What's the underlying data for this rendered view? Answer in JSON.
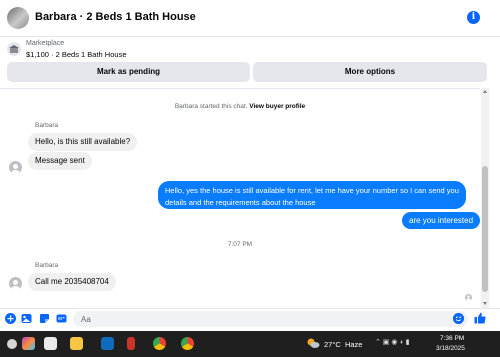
{
  "header": {
    "title": "Barbara · 2 Beds 1 Bath House",
    "info_icon": "info-icon"
  },
  "listing": {
    "label": "Marketplace",
    "detail": "$1,100 · 2 Beds 1 Bath House",
    "pending_label": "Mark as pending",
    "options_label": "More options"
  },
  "chat": {
    "system_text": "Barbara started this chat.",
    "system_link": "View buyer profile",
    "sender": "Barbara",
    "messages": [
      {
        "from": "Barbara",
        "text": "Hello, is this still available?"
      },
      {
        "from": "Barbara",
        "text": "Message sent"
      },
      {
        "from": "me",
        "text": "Hello, yes the house is still available for rent, let me have your number so I can send you details and the requirements about the house"
      },
      {
        "from": "me",
        "text": "are you interested"
      },
      {
        "from": "Barbara",
        "text": "Call me 2035408704"
      }
    ],
    "time_separator": "7:07 PM"
  },
  "composer": {
    "placeholder": "Aa"
  },
  "taskbar": {
    "weather_temp": "27°C",
    "weather_desc": "Haze",
    "time": "7:36 PM",
    "date": "3/18/2025"
  },
  "colors": {
    "accent": "#0866ff",
    "outgoing_bubble": "#0a7cff",
    "incoming_bubble": "#f0f0f0"
  }
}
